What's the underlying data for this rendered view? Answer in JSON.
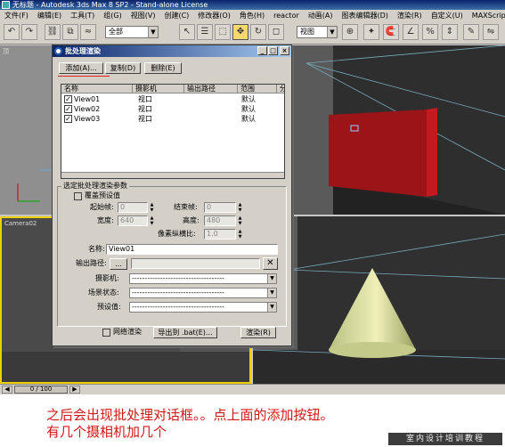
{
  "window": {
    "title": "无标题 - Autodesk 3ds Max 8 SP2  - Stand-alone License"
  },
  "menu": [
    "文件(F)",
    "编辑(E)",
    "工具(T)",
    "组(G)",
    "视图(V)",
    "创建(C)",
    "修改器(O)",
    "角色(H)",
    "reactor",
    "动画(A)",
    "图表编辑器(D)",
    "渲染(R)",
    "自定义(U)",
    "MAXScript(M)"
  ],
  "toolbar": {
    "selection_filter": "全部",
    "view_combo": "视图"
  },
  "viewports": {
    "top_left_label": "顶",
    "bottom_left_label": "Camera02"
  },
  "dialog": {
    "title": "批处理渲染",
    "add_button": "添加(A)...",
    "copy_button": "复制(D)",
    "delete_button": "删除(E)",
    "columns": [
      "名称",
      "摄影机",
      "输出路径",
      "范围",
      "分"
    ],
    "rows": [
      {
        "name": "View01",
        "camera": "视口",
        "path": "",
        "range": "默认",
        "checked": true
      },
      {
        "name": "View02",
        "camera": "视口",
        "path": "",
        "range": "默认",
        "checked": true
      },
      {
        "name": "View03",
        "camera": "视口",
        "path": "",
        "range": "默认",
        "checked": true
      }
    ],
    "params_group": "选定批处理渲染参数",
    "override_label": "覆盖预设值",
    "start_frame_label": "起始帧:",
    "start_frame_value": "0",
    "end_frame_label": "结束帧:",
    "end_frame_value": "0",
    "width_label": "宽度:",
    "width_value": "640",
    "height_label": "高度:",
    "height_value": "480",
    "pixel_aspect_label": "像素纵横比:",
    "pixel_aspect_value": "1.0",
    "name_label": "名称:",
    "name_value": "View01",
    "output_path_label": "输出路径:",
    "browse_label": "...",
    "clear_icon": "x-icon",
    "camera_label": "摄影机:",
    "scene_state_label": "场景状态:",
    "preset_label": "预设值:",
    "dropdown_placeholder": "------------------------------------",
    "net_render_label": "网络渲染",
    "export_button": "导出到 .bat(E)...",
    "render_button": "渲染(R)"
  },
  "timeline": {
    "frame_counter": "0 / 100"
  },
  "caption": {
    "line1": "之后会出现批处理对话框。。点上面的添加按钮。",
    "line2": "有几个摄相机加几个"
  },
  "watermark": "室内设计培训教程",
  "colors": {
    "caption_red": "#d01818",
    "annotation_underline": "#e02020",
    "selection_yellow": "#f0d000"
  }
}
